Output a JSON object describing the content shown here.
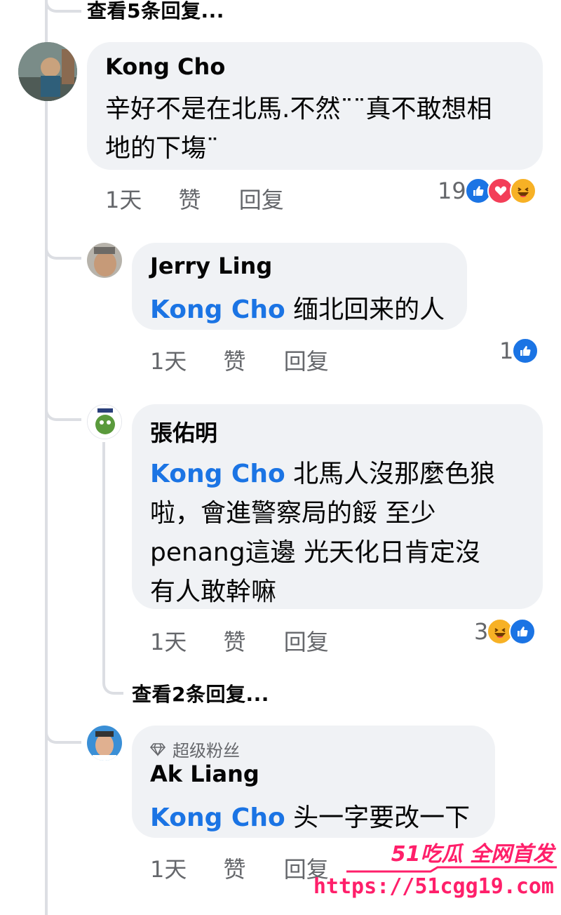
{
  "top_view_more": "查看5条回复...",
  "comments": [
    {
      "author": "Kong Cho",
      "line1": "辛好不是在北馬.不然¨¨真不敢想相",
      "line2": "地的下塲¨",
      "time": "1天",
      "like": "赞",
      "reply": "回复",
      "reaction_count": "19",
      "reactions": [
        "like-icon",
        "love-icon",
        "haha-icon"
      ]
    },
    {
      "author": "Jerry Ling",
      "mention": "Kong Cho",
      "text": "缅北回来的人",
      "time": "1天",
      "like": "赞",
      "reply": "回复",
      "reaction_count": "1",
      "reactions": [
        "like-icon"
      ]
    },
    {
      "author": "張佑明",
      "mention": "Kong Cho",
      "line1": "北馬人沒那麼色狼",
      "line2": "啦，會進警察局的餒 至少",
      "line3": "penang這邊 光天化日肯定沒",
      "line4": "有人敢幹嘛",
      "time": "1天",
      "like": "赞",
      "reply": "回复",
      "reaction_count": "3",
      "reactions": [
        "haha-icon",
        "like-icon"
      ],
      "view_more": "查看2条回复..."
    },
    {
      "badge": "超级粉丝",
      "author": "Ak Liang",
      "mention": "Kong Cho",
      "text": "头一字要改一下",
      "time": "1天",
      "like": "赞",
      "reply": "回复"
    }
  ],
  "watermark": {
    "brand": "51吃瓜 全网首发",
    "url": "https://51cgg19.com"
  },
  "colors": {
    "accent": "#1b74e4",
    "bubble": "#f0f2f5",
    "secondary_text": "#65676b",
    "watermark": "#ff1f6a"
  }
}
